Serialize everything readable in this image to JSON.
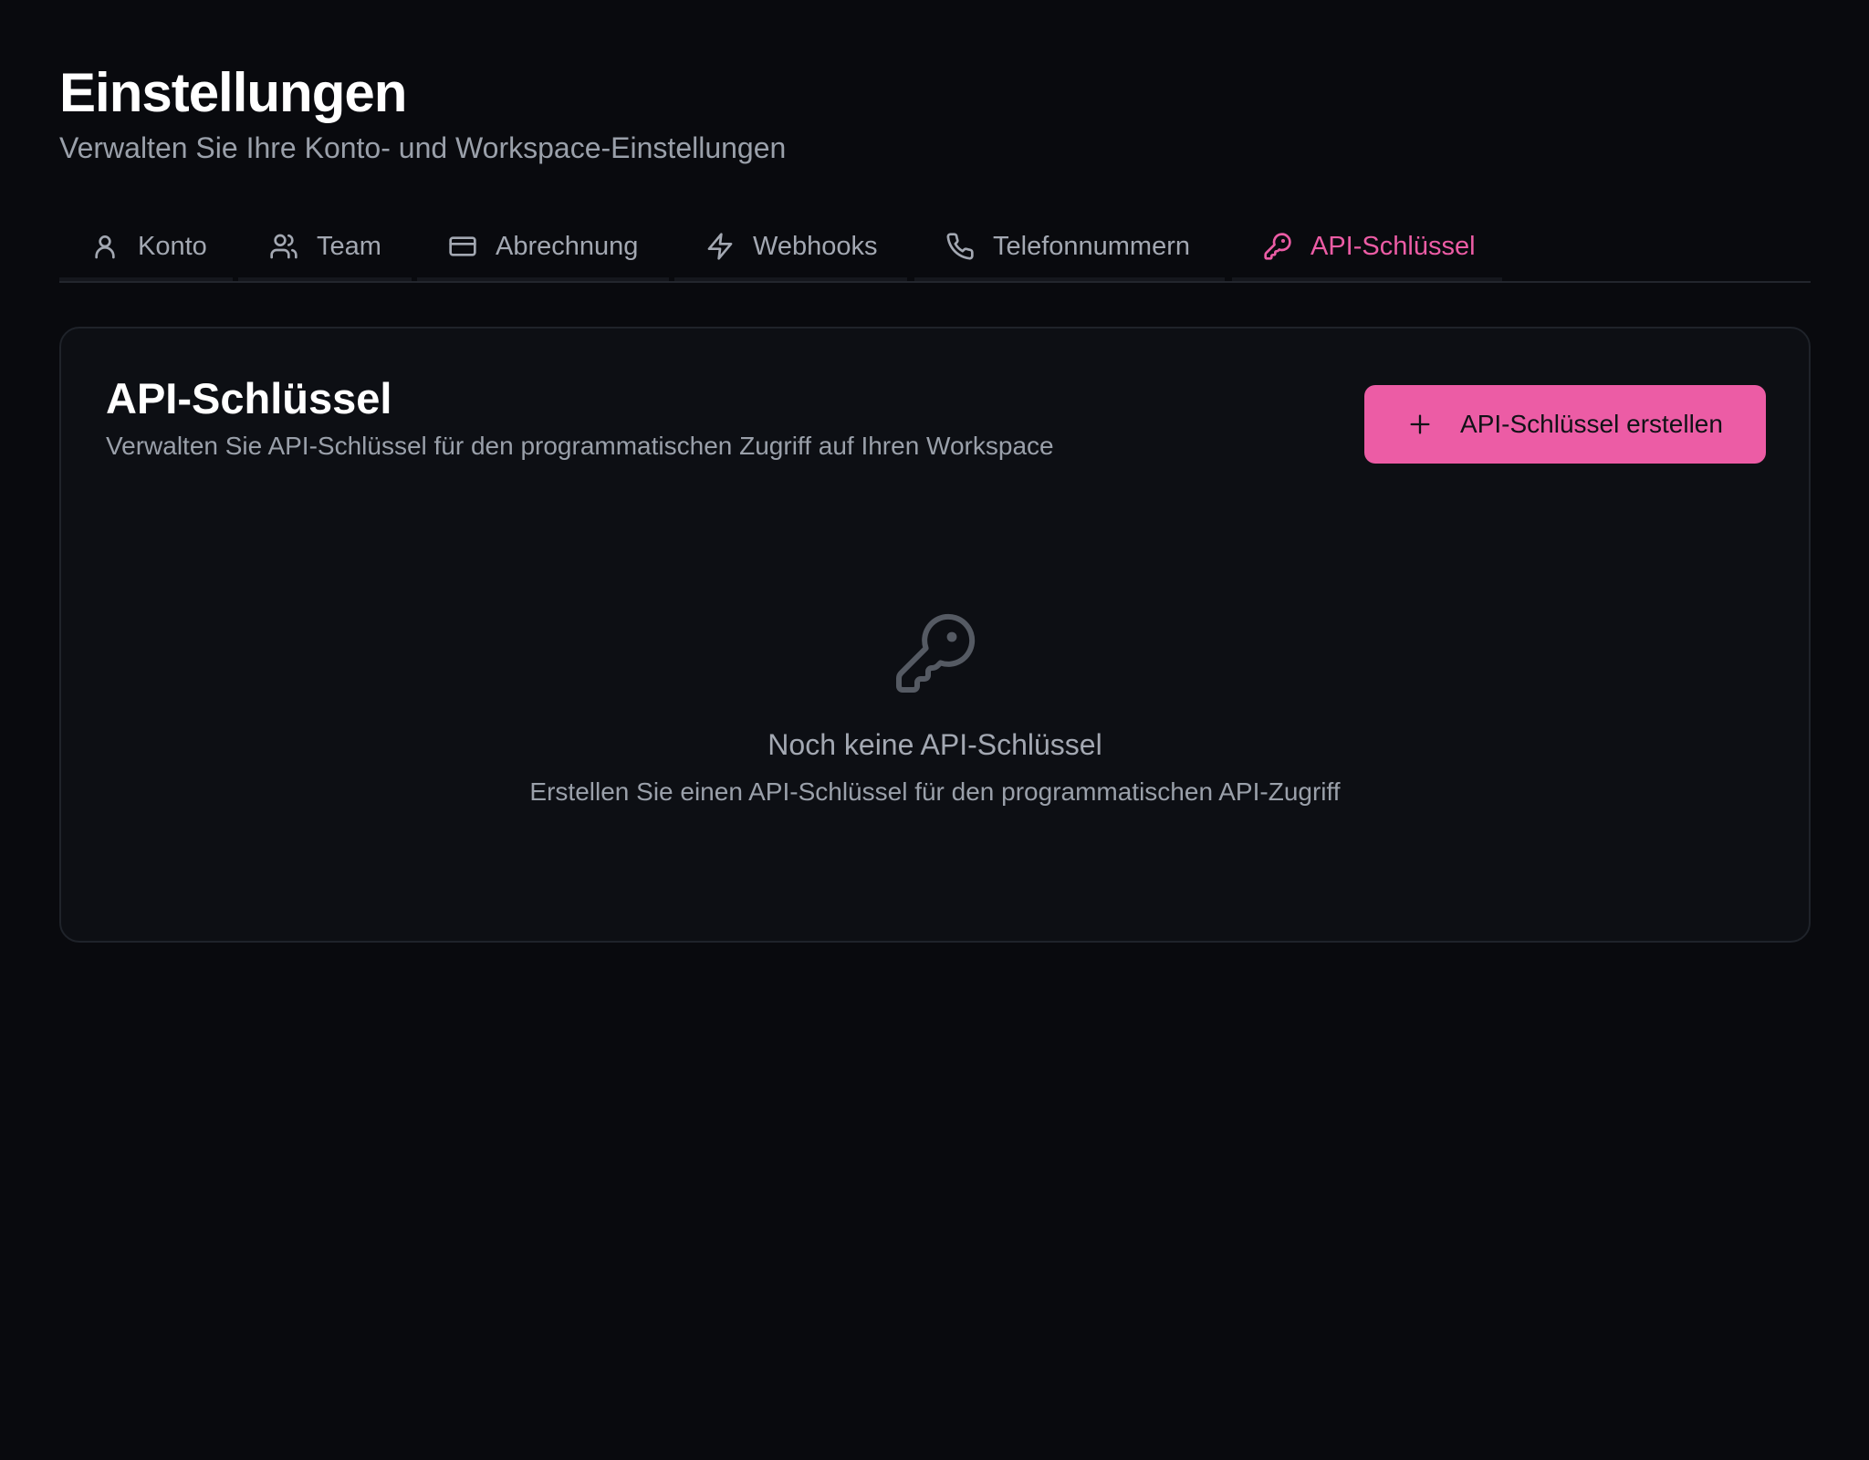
{
  "header": {
    "title": "Einstellungen",
    "subtitle": "Verwalten Sie Ihre Konto- und Workspace-Einstellungen"
  },
  "tabs": [
    {
      "label": "Konto",
      "icon": "user-icon",
      "active": false
    },
    {
      "label": "Team",
      "icon": "users-icon",
      "active": false
    },
    {
      "label": "Abrechnung",
      "icon": "credit-card-icon",
      "active": false
    },
    {
      "label": "Webhooks",
      "icon": "zap-icon",
      "active": false
    },
    {
      "label": "Telefonnummern",
      "icon": "phone-icon",
      "active": false
    },
    {
      "label": "API-Schlüssel",
      "icon": "key-icon",
      "active": true
    }
  ],
  "card": {
    "title": "API-Schlüssel",
    "description": "Verwalten Sie API-Schlüssel für den programmatischen Zugriff auf Ihren Workspace",
    "create_button": "API-Schlüssel erstellen",
    "create_button_icon": "plus-icon",
    "empty_icon": "key-icon",
    "empty_title": "Noch keine API-Schlüssel",
    "empty_description": "Erstellen Sie einen API-Schlüssel für den programmatischen API-Zugriff"
  },
  "colors": {
    "background": "#090a0e",
    "card": "#0d0f14",
    "accent": "#ec5ca5",
    "muted_text": "#9aa0aa"
  }
}
